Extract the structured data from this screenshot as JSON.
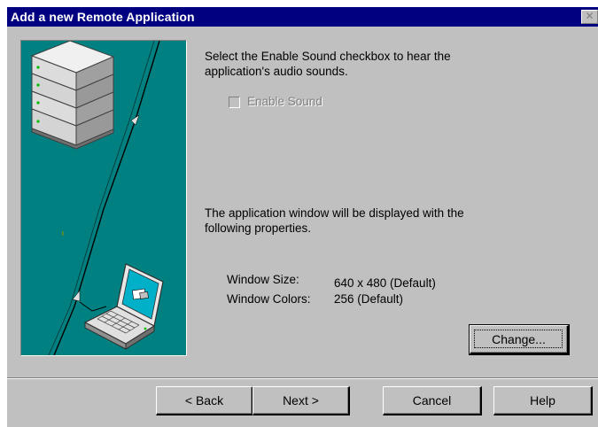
{
  "window": {
    "title": "Add a new Remote Application",
    "close_symbol": "✕"
  },
  "illustration": {
    "description_icons": [
      "server-stack-icon",
      "laptop-icon",
      "connection-line-icon"
    ]
  },
  "sound": {
    "instruction_line1": "Select the Enable Sound checkbox to hear the",
    "instruction_line2": "application's audio sounds.",
    "checkbox_label": "Enable Sound",
    "checked": false,
    "enabled": false
  },
  "display": {
    "info_line1": "The application window will be displayed with the",
    "info_line2": "following properties.",
    "window_size_label": "Window Size:",
    "window_size_value": "640 x 480 (Default)",
    "window_colors_label": "Window Colors:",
    "window_colors_value": "256 (Default)",
    "change_button": "Change..."
  },
  "footer": {
    "back_button": "< Back",
    "next_button": "Next >",
    "cancel_button": "Cancel",
    "help_button": "Help"
  },
  "colors": {
    "title_bar": "#000080",
    "face": "#c0c0c0",
    "illustration_bg": "#008080"
  }
}
